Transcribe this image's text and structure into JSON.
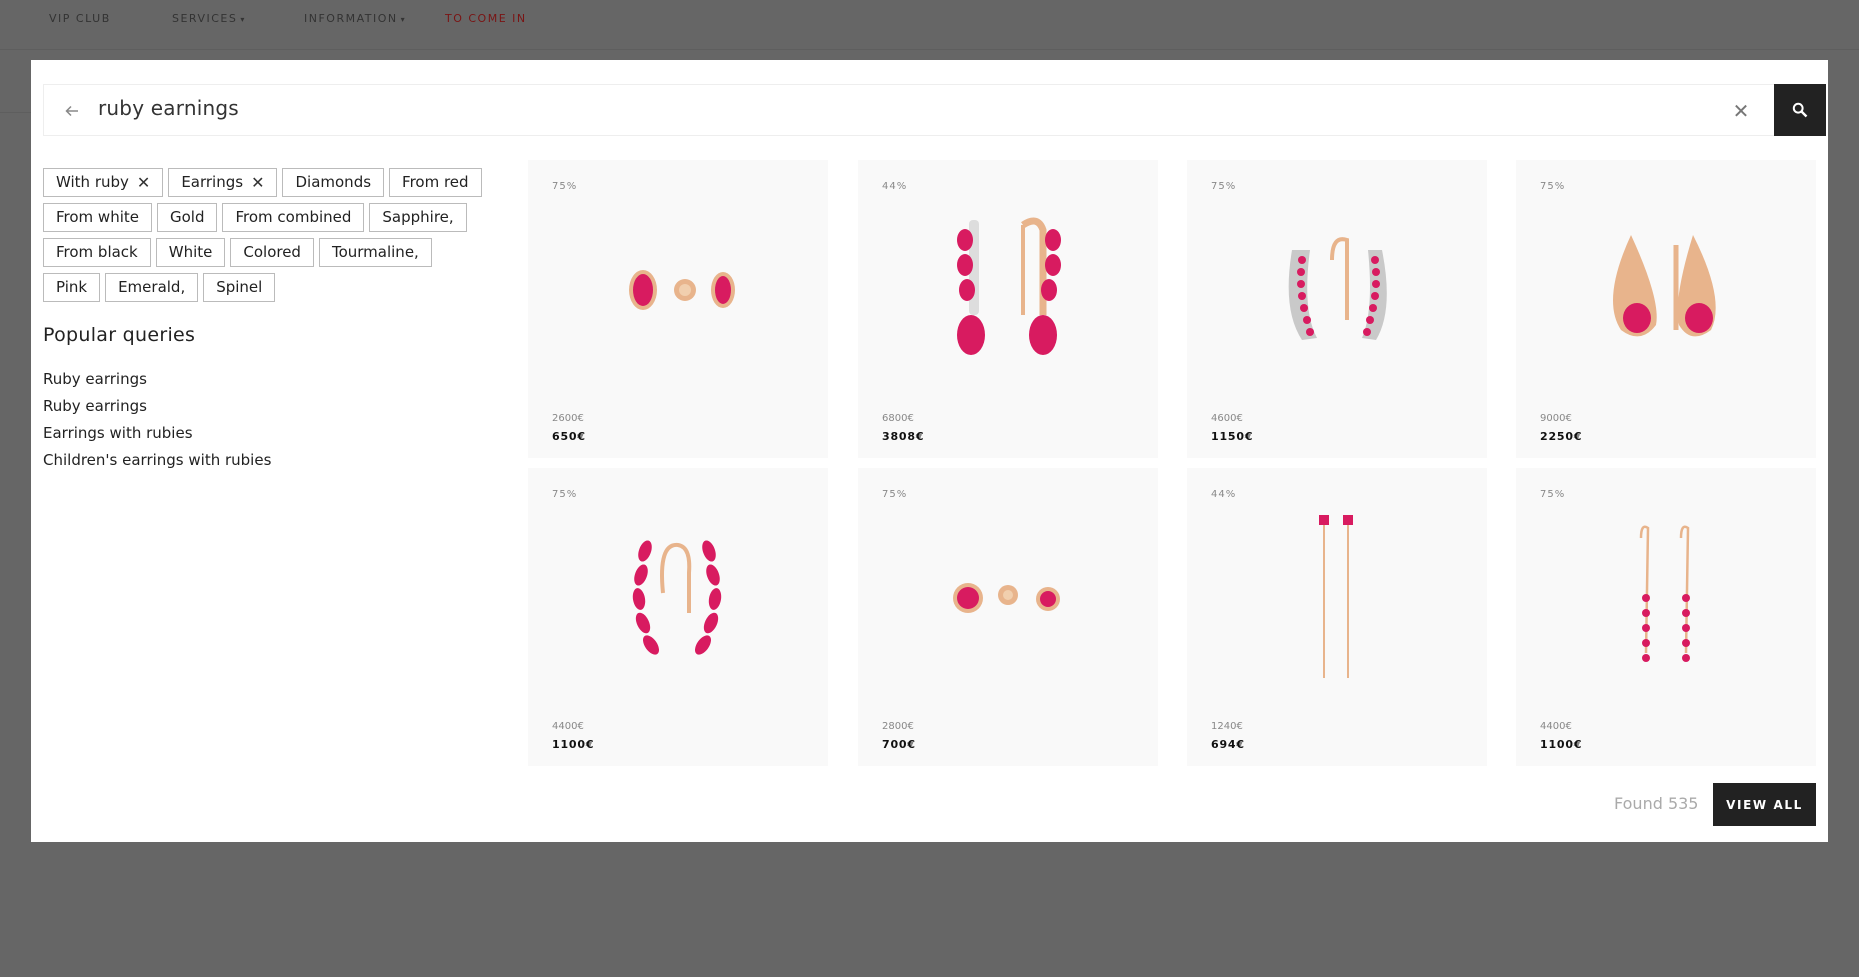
{
  "nav": {
    "vip": "VIP CLUB",
    "services": "SERVICES",
    "information": "INFORMATION",
    "login": "TO COME IN"
  },
  "search": {
    "query": "ruby earnings"
  },
  "filters": [
    [
      {
        "label": "With ruby",
        "active": true
      },
      {
        "label": "Earrings",
        "active": true
      },
      {
        "label": "Diamonds"
      },
      {
        "label": "From red"
      }
    ],
    [
      {
        "label": "From white"
      },
      {
        "label": "Gold"
      },
      {
        "label": "From combined"
      },
      {
        "label": "Sapphire,"
      }
    ],
    [
      {
        "label": "From black"
      },
      {
        "label": "White"
      },
      {
        "label": "Colored"
      },
      {
        "label": "Tourmaline,"
      }
    ],
    [
      {
        "label": "Pink"
      },
      {
        "label": "Emerald,"
      },
      {
        "label": "Spinel"
      }
    ]
  ],
  "popular": {
    "title": "Popular queries",
    "items": [
      "Ruby earrings",
      "Ruby earrings",
      "Earrings with rubies",
      "Children's earrings with rubies"
    ]
  },
  "products": [
    {
      "discount": "75%",
      "old_price": "2600€",
      "price": "650€",
      "icon": "stud-oval-earrings"
    },
    {
      "discount": "44%",
      "old_price": "6800€",
      "price": "3808€",
      "icon": "drop-ruby-earrings"
    },
    {
      "discount": "75%",
      "old_price": "4600€",
      "price": "1150€",
      "icon": "hoop-channel-earrings"
    },
    {
      "discount": "75%",
      "old_price": "9000€",
      "price": "2250€",
      "icon": "teardrop-earrings"
    },
    {
      "discount": "75%",
      "old_price": "4400€",
      "price": "1100€",
      "icon": "marquise-hoop-earrings"
    },
    {
      "discount": "75%",
      "old_price": "2800€",
      "price": "700€",
      "icon": "stud-round-earrings"
    },
    {
      "discount": "44%",
      "old_price": "1240€",
      "price": "694€",
      "icon": "chain-threader-earrings"
    },
    {
      "discount": "75%",
      "old_price": "4400€",
      "price": "1100€",
      "icon": "line-drop-earrings"
    }
  ],
  "footer": {
    "found": "Found 535",
    "view_all": "VIEW ALL"
  },
  "colors": {
    "ruby": "#d81b60",
    "gold": "#e8b48c",
    "dark": "#222222"
  }
}
